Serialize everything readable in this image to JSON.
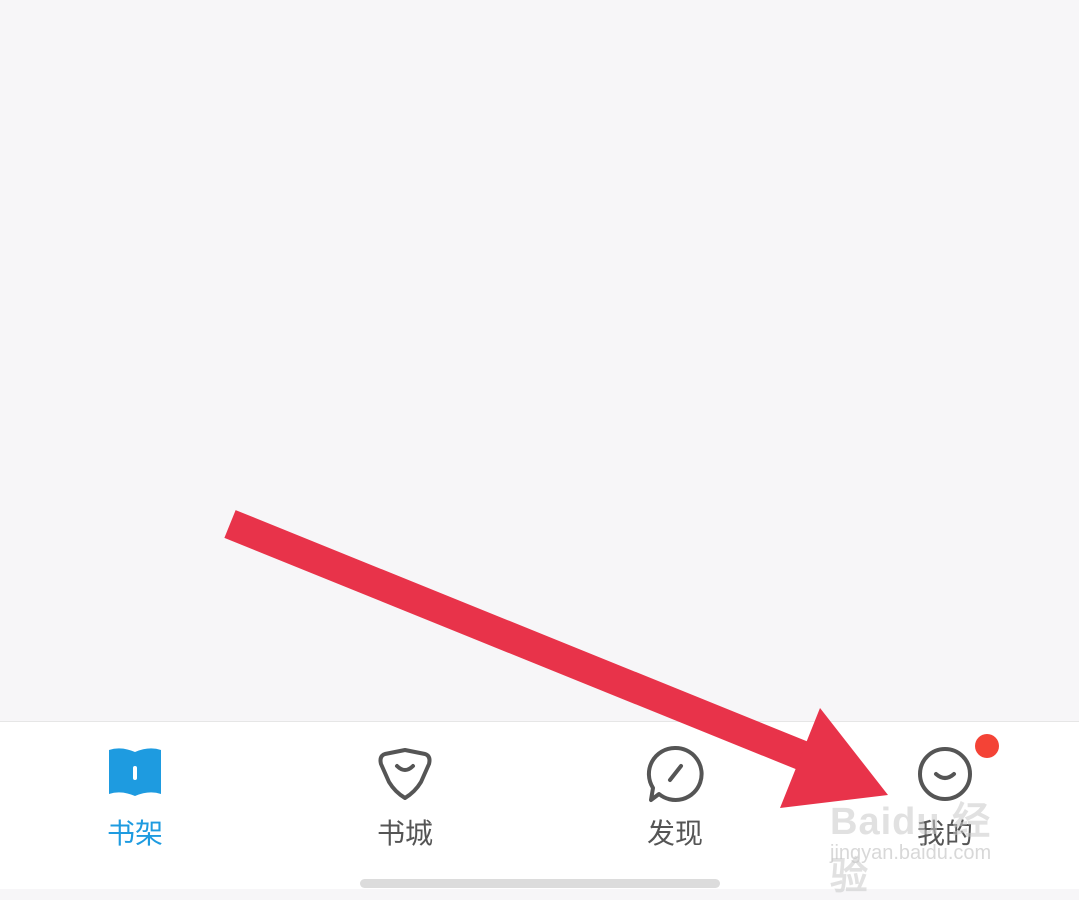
{
  "tabs": [
    {
      "label": "书架",
      "icon": "bookshelf-icon",
      "active": true
    },
    {
      "label": "书城",
      "icon": "bookstore-icon",
      "active": false
    },
    {
      "label": "发现",
      "icon": "discover-icon",
      "active": false
    },
    {
      "label": "我的",
      "icon": "profile-icon",
      "active": false,
      "badge": true
    }
  ],
  "watermark": {
    "logo": "Baidu 经验",
    "sub": "jingyan.baidu.com"
  },
  "colors": {
    "accent": "#1e9be0",
    "inactive": "#555555",
    "badge": "#f44336",
    "arrow": "#e8334a",
    "background": "#f7f6f8"
  }
}
